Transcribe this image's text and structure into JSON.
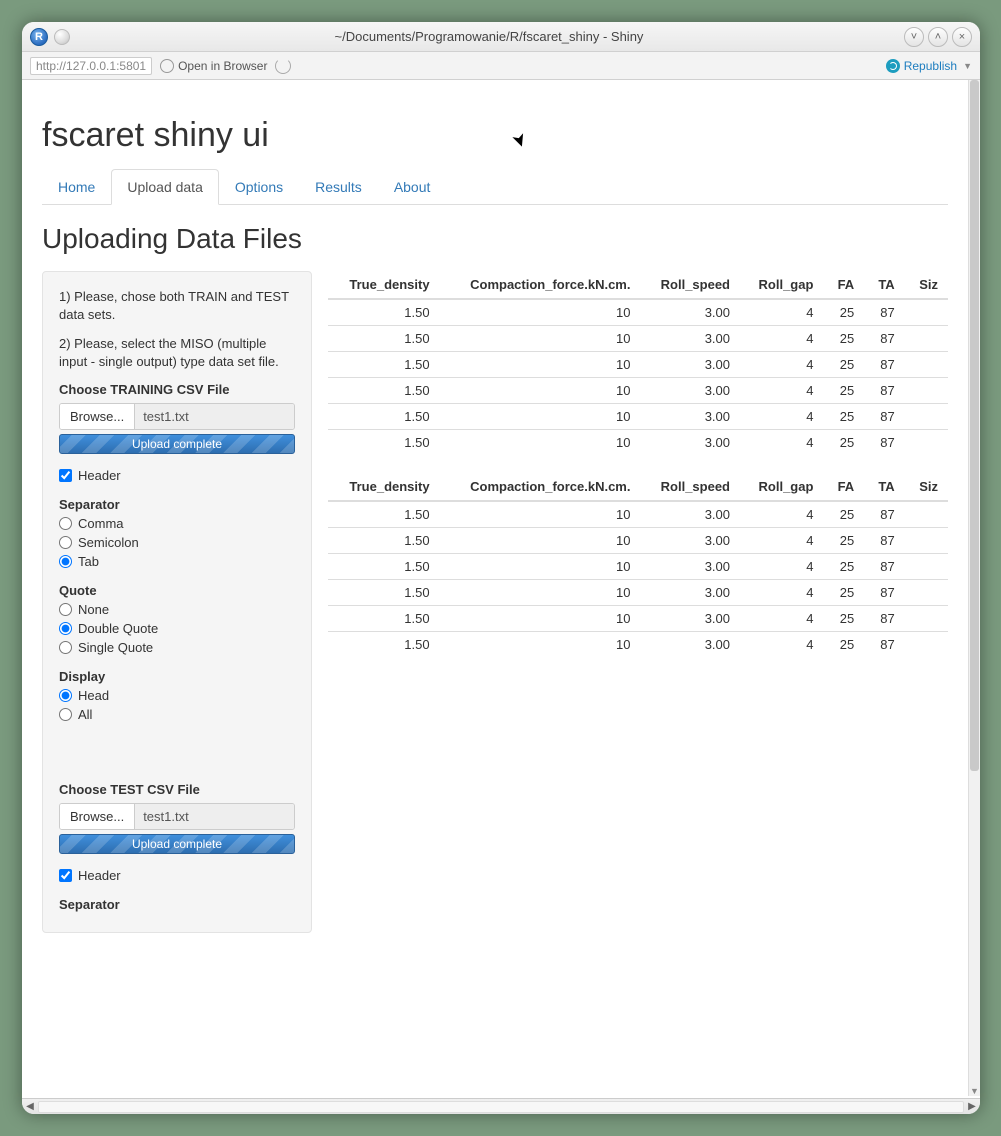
{
  "window": {
    "title": "~/Documents/Programowanie/R/fscaret_shiny - Shiny",
    "r_icon_letter": "R"
  },
  "toolbar": {
    "url": "http://127.0.0.1:5801",
    "open_browser": "Open in Browser",
    "republish": "Republish"
  },
  "app": {
    "title": "fscaret shiny ui",
    "section_title": "Uploading Data Files"
  },
  "tabs": [
    "Home",
    "Upload data",
    "Options",
    "Results",
    "About"
  ],
  "active_tab": "Upload data",
  "sidebar": {
    "hint1": "1) Please, chose both TRAIN and TEST data sets.",
    "hint2": "2) Please, select the MISO (multiple input - single output) type data set file.",
    "train_label": "Choose TRAINING CSV File",
    "test_label": "Choose TEST CSV File",
    "browse": "Browse...",
    "train_file": "test1.txt",
    "test_file": "test1.txt",
    "upload_status": "Upload complete",
    "header_label": "Header",
    "separator_label": "Separator",
    "separators": [
      "Comma",
      "Semicolon",
      "Tab"
    ],
    "separator_selected": "Tab",
    "quote_label": "Quote",
    "quotes": [
      "None",
      "Double Quote",
      "Single Quote"
    ],
    "quote_selected": "Double Quote",
    "display_label": "Display",
    "displays": [
      "Head",
      "All"
    ],
    "display_selected": "Head",
    "separator2_label": "Separator"
  },
  "table": {
    "headers": [
      "True_density",
      "Compaction_force.kN.cm.",
      "Roll_speed",
      "Roll_gap",
      "FA",
      "TA",
      "Size"
    ],
    "rows": [
      [
        "1.50",
        "10",
        "3.00",
        "4",
        "25",
        "87"
      ],
      [
        "1.50",
        "10",
        "3.00",
        "4",
        "25",
        "87"
      ],
      [
        "1.50",
        "10",
        "3.00",
        "4",
        "25",
        "87"
      ],
      [
        "1.50",
        "10",
        "3.00",
        "4",
        "25",
        "87"
      ],
      [
        "1.50",
        "10",
        "3.00",
        "4",
        "25",
        "87"
      ],
      [
        "1.50",
        "10",
        "3.00",
        "4",
        "25",
        "87"
      ]
    ]
  }
}
